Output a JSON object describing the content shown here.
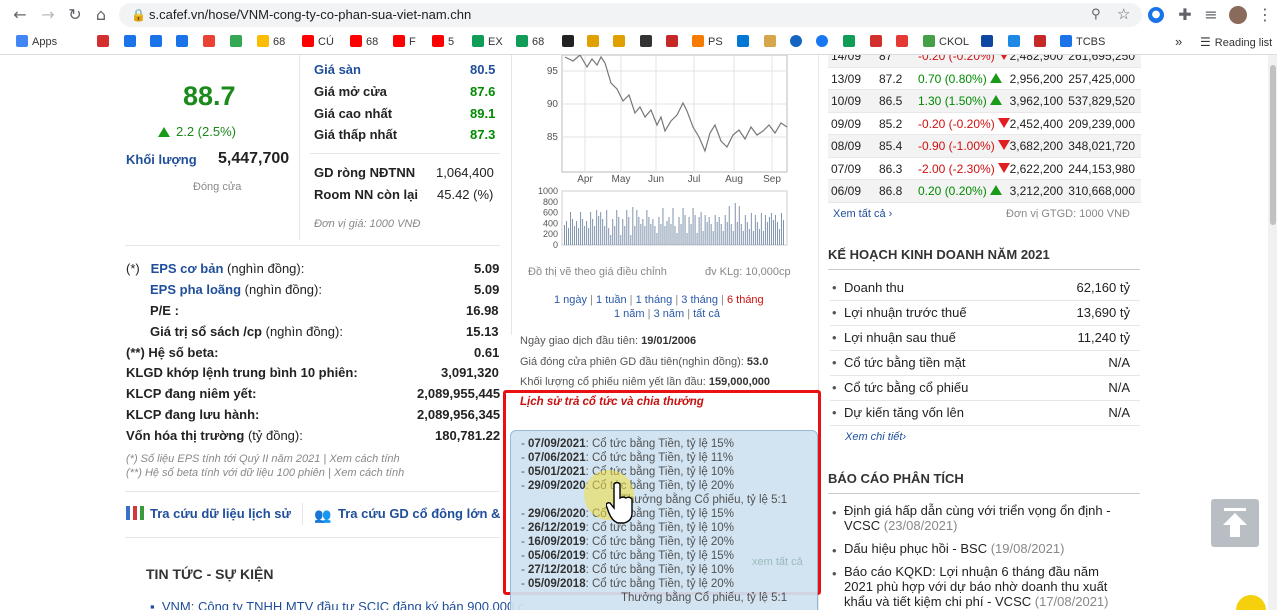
{
  "browser": {
    "url": "s.cafef.vn/hose/VNM-cong-ty-co-phan-sua-viet-nam.chn",
    "bookmarks": [
      "Apps",
      "68",
      "CÚ",
      "68",
      "F",
      "5",
      "EX",
      "68",
      "PS",
      "CKOL",
      "TCBS"
    ],
    "reading_list": "Reading list",
    "more": "»"
  },
  "price": {
    "current": "88.7",
    "change": "2.2 (2.5%)",
    "volume_label": "Khối lượng",
    "volume": "5,447,700",
    "status": "Đóng cửa"
  },
  "summary": [
    {
      "label": "Giá sàn",
      "value": "80.5"
    },
    {
      "label": "Giá mở cửa",
      "value": "87.6"
    },
    {
      "label": "Giá cao nhất",
      "value": "89.1"
    },
    {
      "label": "Giá thấp nhất",
      "value": "87.3"
    }
  ],
  "foreign": [
    {
      "label": "GD ròng NĐTNN",
      "value": "1,064,400"
    },
    {
      "label": "Room NN còn lại",
      "value": "45.42 (%)"
    }
  ],
  "unit_price": "Đơn vị giá: 1000 VNĐ",
  "fundamentals": {
    "eps_prefix": "(*)",
    "eps_label": "EPS cơ bản",
    "eps_unit": "(nghìn đồng):",
    "eps_value": "5.09",
    "eps_diluted_label": "EPS pha loãng",
    "eps_diluted_unit": "(nghìn đồng):",
    "eps_diluted_value": "5.09",
    "pe_label": "P/E :",
    "pe_value": "16.98",
    "book_label": "Giá trị sổ sách /cp",
    "book_unit": "(nghìn đồng):",
    "book_value": "15.13",
    "beta_label": "(**) Hệ số beta:",
    "beta_value": "0.61",
    "klgd_label": "KLGD khớp lệnh trung bình 10 phiên:",
    "klgd_value": "3,091,320",
    "listed_label": "KLCP đang niêm yết:",
    "listed_value": "2,089,955,445",
    "outstanding_label": "KLCP đang lưu hành:",
    "outstanding_value": "2,089,956,345",
    "cap_label": "Vốn hóa thị trường",
    "cap_unit": "(tỷ đồng):",
    "cap_value": "180,781.22",
    "note1": "(*) Số liệu EPS tính tới Quý II năm 2021 | Xem cách tính",
    "note2": "(**) Hệ số beta tính với dữ liệu 100 phiên | Xem cách tính"
  },
  "links": {
    "history": "Tra cứu dữ liệu lịch sử",
    "shareholder": "Tra cứu GD cổ đông lớn &"
  },
  "news_title": "TIN TỨC - SỰ KIỆN",
  "news_first": "VNM: Công ty TNHH MTV đầu tư SCIC đăng ký bán 900,000 c",
  "chart": {
    "y_labels": [
      "95",
      "90",
      "85"
    ],
    "x_labels": [
      "Apr",
      "May",
      "Jun",
      "Jul",
      "Aug",
      "Sep"
    ],
    "vol_labels": [
      "1000",
      "800",
      "600",
      "400",
      "200",
      "0"
    ],
    "caption_left": "Đồ thị vẽ theo giá điều chỉnh",
    "caption_right": "đv KLg: 10,000cp",
    "periods_line1": [
      "1 ngày",
      "1 tuần",
      "1 tháng",
      "3 tháng",
      "6 tháng"
    ],
    "periods_line2": [
      "1 năm",
      "3 năm",
      "tất cả"
    ],
    "sep": "|"
  },
  "listing": {
    "first_day_label": "Ngày giao dịch đầu tiên:",
    "first_day": "19/01/2006",
    "first_close_label": "Giá đóng cửa phiên GD đầu tiên(nghìn đồng):",
    "first_close": "53.0",
    "first_volume_label": "Khối lượng cổ phiếu niêm yết lần đầu:",
    "first_volume": "159,000,000"
  },
  "dividend": {
    "title": "Lịch sử trả cổ tức và chia thưởng",
    "items": [
      {
        "date": "07/09/2021",
        "text": ": Cổ tức bằng Tiền, tỷ lệ 15%"
      },
      {
        "date": "07/06/2021",
        "text": ": Cổ tức bằng Tiền, tỷ lệ 11%"
      },
      {
        "date": "05/01/2021",
        "text": ": Cổ tức bằng Tiền, tỷ lệ 10%"
      },
      {
        "date": "29/09/2020",
        "text": ": Cổ tức bằng Tiền, tỷ lệ 20%"
      },
      {
        "date": "",
        "text": "Thưởng bằng Cổ phiếu, tỷ lệ 5:1"
      },
      {
        "date": "29/06/2020",
        "text": ": Cổ tức bằng Tiền, tỷ lệ 15%"
      },
      {
        "date": "26/12/2019",
        "text": ": Cổ tức bằng Tiền, tỷ lệ 10%"
      },
      {
        "date": "16/09/2019",
        "text": ": Cổ tức bằng Tiền, tỷ lệ 20%"
      },
      {
        "date": "05/06/2019",
        "text": ": Cổ tức bằng Tiền, tỷ lệ 15%"
      },
      {
        "date": "27/12/2018",
        "text": ": Cổ tức bằng Tiền, tỷ lệ 10%"
      },
      {
        "date": "05/09/2018",
        "text": ": Cổ tức bằng Tiền, tỷ lệ 20%"
      },
      {
        "date": "",
        "text": "Thưởng bằng Cổ phiếu, tỷ lệ 5:1"
      }
    ],
    "see_all": "xem tất cả"
  },
  "history": {
    "rows": [
      {
        "date": "14/09",
        "price": "87",
        "change": "-0.20 (-0.20%)",
        "dir": "down",
        "vol": "2,482,900",
        "value": "261,695,250"
      },
      {
        "date": "13/09",
        "price": "87.2",
        "change": "0.70 (0.80%)",
        "dir": "up",
        "vol": "2,956,200",
        "value": "257,425,000"
      },
      {
        "date": "10/09",
        "price": "86.5",
        "change": "1.30 (1.50%)",
        "dir": "up",
        "vol": "3,962,100",
        "value": "537,829,520"
      },
      {
        "date": "09/09",
        "price": "85.2",
        "change": "-0.20 (-0.20%)",
        "dir": "down",
        "vol": "2,452,400",
        "value": "209,239,000"
      },
      {
        "date": "08/09",
        "price": "85.4",
        "change": "-0.90 (-1.00%)",
        "dir": "down",
        "vol": "3,682,200",
        "value": "348,021,720"
      },
      {
        "date": "07/09",
        "price": "86.3",
        "change": "-2.00 (-2.30%)",
        "dir": "down",
        "vol": "2,622,200",
        "value": "244,153,980"
      },
      {
        "date": "06/09",
        "price": "86.8",
        "change": "0.20 (0.20%)",
        "dir": "up",
        "vol": "3,212,200",
        "value": "310,668,000"
      }
    ],
    "see_all": "Xem tất cả",
    "unit": "Đơn vị GTGD: 1000 VNĐ"
  },
  "plan": {
    "title": "KẾ HOẠCH KINH DOANH NĂM 2021",
    "items": [
      {
        "label": "Doanh thu",
        "value": "62,160 tỷ"
      },
      {
        "label": "Lợi nhuận trước thuế",
        "value": "13,690 tỷ"
      },
      {
        "label": "Lợi nhuận sau thuế",
        "value": "11,240 tỷ"
      },
      {
        "label": "Cổ tức bằng tiền mặt",
        "value": "N/A"
      },
      {
        "label": "Cổ tức bằng cổ phiếu",
        "value": "N/A"
      },
      {
        "label": "Dự kiến tăng vốn lên",
        "value": "N/A"
      }
    ],
    "see_detail": "Xem chi tiết"
  },
  "reports": {
    "title": "BÁO CÁO PHÂN TÍCH",
    "items": [
      {
        "text": "Định giá hấp dẫn cùng với triển vọng ổn định - VCSC",
        "date": "(23/08/2021)"
      },
      {
        "text": "Dấu hiệu phục hồi - BSC",
        "date": "(19/08/2021)"
      },
      {
        "text": "Báo cáo KQKD: Lợi nhuận 6 tháng đầu năm 2021 phù hợp với dự báo nhờ doanh thu xuất khẩu và tiết kiệm chi phí - VCSC",
        "date": "(17/08/2021)"
      }
    ]
  }
}
